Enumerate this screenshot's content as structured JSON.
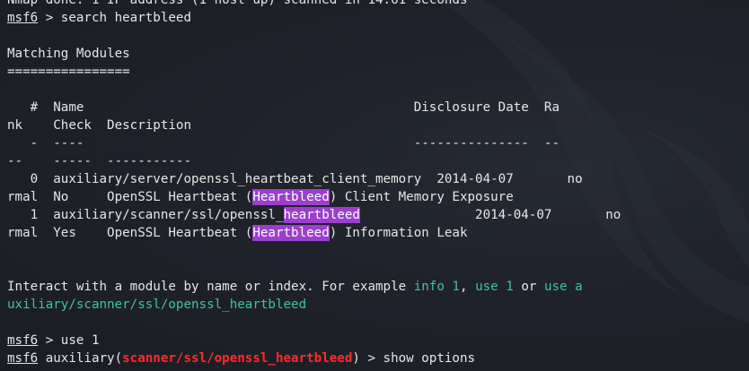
{
  "lines": {
    "l0": "Nmap done: 1 IP address (1 host up) scanned in 14.61 seconds",
    "l1_prompt": "msf6",
    "l1_cmd": " > search heartbleed",
    "l3": "Matching Modules",
    "l4": "================",
    "l6": "   #  Name                                           Disclosure Date  Ra",
    "l7": "nk    Check  Description",
    "l8": "   -  ----                                           ---------------  --",
    "l9": "--    -----  -----------",
    "r0a": "   0  auxiliary/server/openssl_heartbeat_client_memory  2014-04-07       no",
    "r0b_pre": "rmal  No     OpenSSL Heartbeat (",
    "r0b_hl": "Heartbleed",
    "r0b_post": ") Client Memory Exposure",
    "r1a_pre": "   1  auxiliary/scanner/ssl/openssl_",
    "r1a_hl": "heartbleed",
    "r1a_post": "               2014-04-07       no",
    "r1b_pre": "rmal  Yes    OpenSSL Heartbeat (",
    "r1b_hl": "Heartbleed",
    "r1b_post": ") Information Leak",
    "i1_pre": "Interact with a module by name or index. For example ",
    "i1_info": "info 1",
    "i1_mid1": ", ",
    "i1_use1": "use 1",
    "i1_mid2": " or ",
    "i1_usea": "use a",
    "i2": "uxiliary/scanner/ssl/openssl_heartbleed",
    "p1_prompt": "msf6",
    "p1_cmd": " > use 1",
    "p2_prompt": "msf6",
    "p2_pre": " auxiliary(",
    "p2_module": "scanner/ssl/openssl_heartbleed",
    "p2_post": ") > show options"
  },
  "colors": {
    "background": "#1f222a",
    "text": "#e6e6e6",
    "green": "#3fc3a5",
    "red": "#ff2b2b",
    "highlight": "#9b3fcf"
  }
}
